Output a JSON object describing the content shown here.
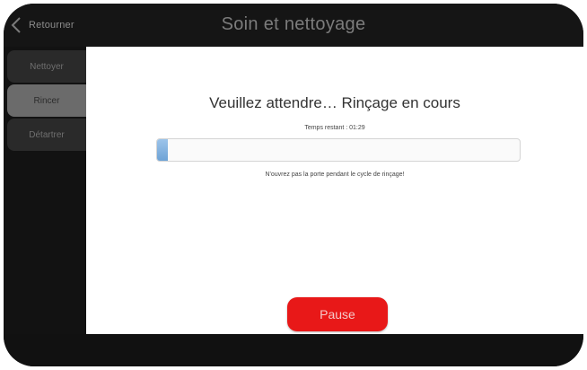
{
  "header": {
    "back_label": "Retourner",
    "title": "Soin et nettoyage"
  },
  "sidebar": {
    "items": [
      {
        "label": "Nettoyer",
        "selected": false
      },
      {
        "label": "Rincer",
        "selected": true
      },
      {
        "label": "Détartrer",
        "selected": false
      }
    ]
  },
  "main": {
    "status_heading": "Veuillez attendre… Rinçage en cours",
    "time_remaining": "Temps restant : 01:29",
    "progress_percent": 3,
    "warning": "N'ouvrez pas la porte pendant le cycle de rinçage!",
    "pause_label": "Pause"
  },
  "colors": {
    "accent_pause": "#e81818",
    "progress_fill": "#7fb0de"
  },
  "icons": {
    "back": "chevron-left-icon"
  }
}
